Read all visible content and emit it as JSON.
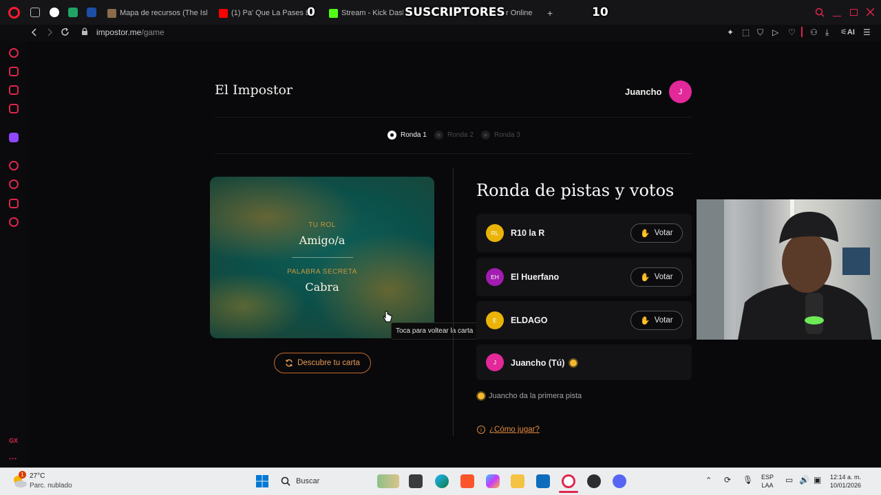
{
  "browser": {
    "tabs": [
      {
        "label": "Mapa de recursos (The Isla"
      },
      {
        "label": "(1) Pa' Que La Pases Bie"
      },
      {
        "label": "Stream - Kick Dash"
      },
      {
        "label": "r Online"
      }
    ],
    "stream_overlay": {
      "left_count": "0",
      "title": "SUSCRIPTORES",
      "right_count": "10"
    },
    "tab_add": "+",
    "url_host": "impostor.me",
    "url_path": "/game",
    "ai_label": "AI"
  },
  "header": {
    "brand": "El Impostor",
    "user_name": "Juancho",
    "user_initial": "J"
  },
  "rounds": [
    {
      "label": "Ronda 1",
      "active": true
    },
    {
      "label": "Ronda 2",
      "active": false
    },
    {
      "label": "Ronda 3",
      "active": false
    }
  ],
  "card": {
    "role_label": "TU ROL",
    "role_value": "Amigo/a",
    "word_label": "PALABRA SECRETA",
    "word_value": "Cabra",
    "tooltip": "Toca para voltear la carta",
    "reveal_button": "Descubre tu carta"
  },
  "voting": {
    "title": "Ronda de pistas y votos",
    "vote_label": "Votar",
    "players": [
      {
        "initials": "RL",
        "name": "R10 la R",
        "color": "#eab308",
        "can_vote": true
      },
      {
        "initials": "EH",
        "name": "El Huerfano",
        "color": "#a21caf",
        "can_vote": true
      },
      {
        "initials": "E",
        "name": "ELDAGO",
        "color": "#eab308",
        "can_vote": true
      },
      {
        "initials": "J",
        "name": "Juancho (Tú)",
        "color": "#e3289a",
        "can_vote": false
      }
    ],
    "hint": "Juancho da la primera pista",
    "how_to": "¿Cómo jugar?"
  },
  "taskbar": {
    "temperature": "27°C",
    "weather": "Parc. nublado",
    "weather_badge": "1",
    "search_placeholder": "Buscar",
    "lang_top": "ESP",
    "lang_bottom": "LAA",
    "time": "12:14 a. m.",
    "date": "10/01/2026"
  }
}
